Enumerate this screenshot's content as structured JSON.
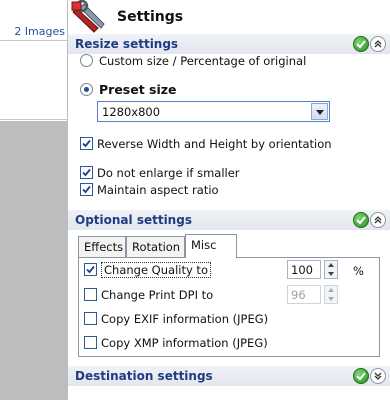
{
  "left": {
    "image_count": "2 Images"
  },
  "header": {
    "title": "Settings"
  },
  "resize": {
    "title": "Resize settings",
    "options": {
      "custom": "Custom size / Percentage of original",
      "preset": "Preset size"
    },
    "preset_value": "1280x800",
    "reverse": "Reverse Width and Height by orientation",
    "no_enlarge": "Do not enlarge if smaller",
    "maintain": "Maintain aspect ratio"
  },
  "optional": {
    "title": "Optional settings",
    "tabs": [
      "Effects",
      "Rotation",
      "Misc"
    ],
    "misc": {
      "quality_label": "Change Quality to",
      "quality_value": "100",
      "percent": "%",
      "dpi_label": "Change Print DPI to",
      "dpi_value": "96",
      "exif_label": "Copy EXIF information (JPEG)",
      "xmp_label": "Copy XMP information (JPEG)"
    }
  },
  "destination": {
    "title": "Destination settings"
  },
  "colors": {
    "section_title": "#1f3c82",
    "link": "#2a4f9e",
    "check_green": "#2e8b2a"
  },
  "icons": [
    "settings-wrench-icon",
    "green-check-icon",
    "collapse-up-icon",
    "expand-down-icon",
    "dropdown-arrow-icon"
  ]
}
